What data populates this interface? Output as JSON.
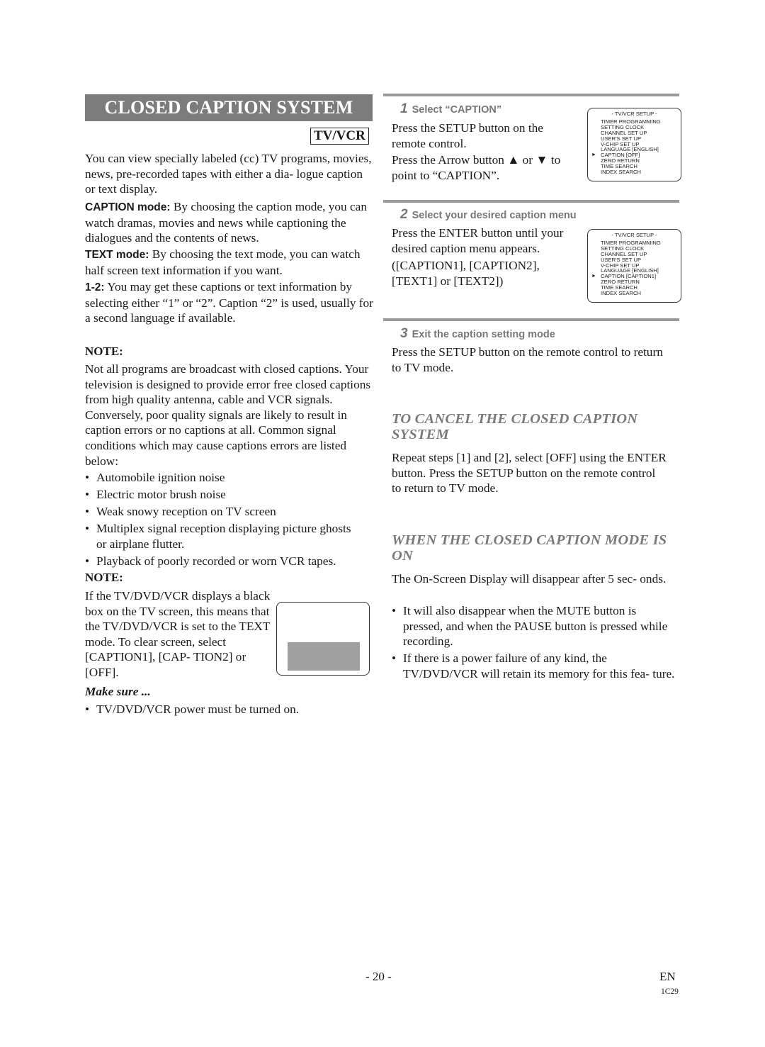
{
  "title": "CLOSED CAPTION SYSTEM",
  "badge": "TV/VCR",
  "left": {
    "intro": "You can view specially labeled (cc) TV programs, movies, news, pre-recorded tapes with either a dia- logue caption or text display.",
    "caption_mode_label": "CAPTION mode:",
    "caption_mode_text": " By choosing the caption mode, you can watch dramas, movies and news while captioning the dialogues and the contents of news.",
    "text_mode_label": "TEXT mode:",
    "text_mode_text": " By choosing the text mode, you can watch half screen text information if you want.",
    "one_two_label": "1-2:",
    "one_two_text": " You may get these captions or text information by selecting either “1” or “2”. Caption “2” is used, usually for a second language if available.",
    "note1_heading": "NOTE:",
    "note1_text": "Not all programs are broadcast with closed captions. Your television is designed to provide error free closed captions from high quality antenna, cable and VCR signals. Conversely, poor quality signals are likely to result in caption errors or no captions at all. Common signal conditions which may cause captions errors are listed below:",
    "conditions": [
      "Automobile ignition noise",
      "Electric motor brush noise",
      "Weak snowy reception on TV screen",
      "Multiplex signal reception displaying picture ghosts or airplane flutter.",
      "Playback of poorly recorded or worn VCR tapes."
    ],
    "note2_heading": "NOTE:",
    "note2_text": "If the TV/DVD/VCR displays a black box on the TV screen, this means that the TV/DVD/VCR is set to the TEXT mode. To clear screen, select [CAPTION1], [CAP- TION2] or [OFF].",
    "make_sure_heading": "Make sure ...",
    "make_sure_items": [
      "TV/DVD/VCR power must be turned on."
    ]
  },
  "steps": [
    {
      "number": "1",
      "heading": "Select “CAPTION”",
      "text1": "Press the SETUP button on the remote control.",
      "text2": "Press the Arrow button ▲ or ▼ to point to “CAPTION”."
    },
    {
      "number": "2",
      "heading": "Select your desired caption menu",
      "text1": "Press the ENTER button until your desired caption menu appears.",
      "text2": "([CAPTION1], [CAPTION2], [TEXT1] or [TEXT2])"
    },
    {
      "number": "3",
      "heading": "Exit the caption setting mode",
      "text1": "Press the SETUP button on the remote control to return to TV mode."
    }
  ],
  "osd1": {
    "title": "- TV/VCR SETUP -",
    "items": [
      "TIMER PROGRAMMING",
      "SETTING CLOCK",
      "CHANNEL SET UP",
      "USER'S SET UP",
      "V-CHIP SET UP",
      "LANGUAGE  [ENGLISH]",
      "CAPTION  [OFF]",
      "ZERO RETURN",
      "TIME SEARCH",
      "INDEX SEARCH"
    ],
    "cursor": "►"
  },
  "osd2": {
    "title": "- TV/VCR SETUP -",
    "items": [
      "TIMER PROGRAMMING",
      "SETTING CLOCK",
      "CHANNEL SET UP",
      "USER'S SET UP",
      "V-CHIP SET UP",
      "LANGUAGE  [ENGLISH]",
      "CAPTION  [CAPTION1]",
      "ZERO RETURN",
      "TIME SEARCH",
      "INDEX SEARCH"
    ],
    "cursor": "►"
  },
  "cancel": {
    "heading": "TO CANCEL THE CLOSED CAPTION SYSTEM",
    "text": "Repeat steps [1] and [2], select [OFF] using the ENTER button. Press the SETUP button on the remote control to return to TV mode."
  },
  "when_on": {
    "heading": "WHEN THE CLOSED CAPTION MODE IS ON",
    "text": "The On-Screen Display will disappear after 5 sec- onds.",
    "bullets": [
      "It will also disappear when the MUTE button is pressed, and when the PAUSE button is pressed while recording.",
      "If there is a power failure of any kind, the TV/DVD/VCR will retain its memory for this fea- ture."
    ]
  },
  "footer": {
    "page_number": "- 20 -",
    "language": "EN",
    "model_code": "1C29"
  }
}
